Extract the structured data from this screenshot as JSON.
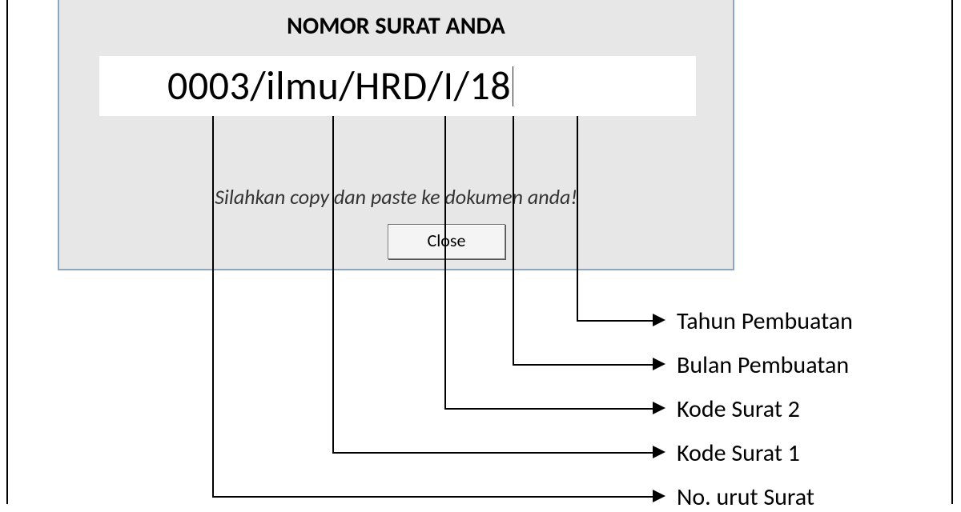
{
  "dialog": {
    "title": "NOMOR SURAT ANDA",
    "letter_number": "0003/ilmu/HRD/I/18",
    "helper_text": "Silahkan copy dan paste ke dokumen anda!",
    "close_label": "Close"
  },
  "annotations": {
    "tahun": "Tahun Pembuatan",
    "bulan": "Bulan Pembuatan",
    "kode2": "Kode Surat 2",
    "kode1": "Kode Surat 1",
    "no_urut": "No. urut Surat"
  }
}
